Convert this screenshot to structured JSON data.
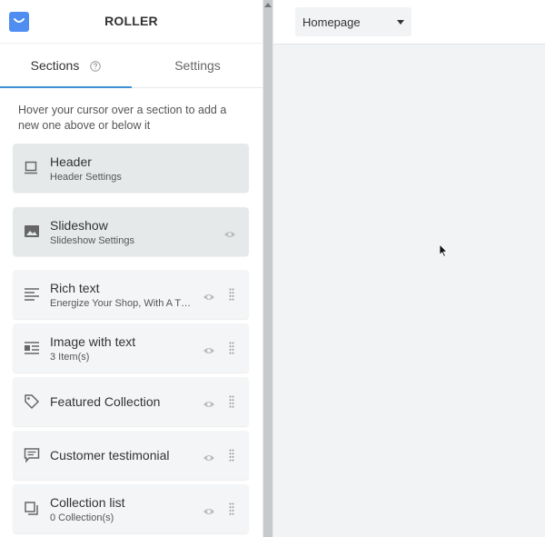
{
  "app": {
    "title": "ROLLER"
  },
  "tabs": {
    "sections": "Sections",
    "settings": "Settings"
  },
  "hint": "Hover your cursor over a section to add a new one above or below it",
  "sections": [
    {
      "name": "Header",
      "sub": "Header Settings",
      "icon": "header-icon"
    },
    {
      "name": "Slideshow",
      "sub": "Slideshow Settings",
      "icon": "image-icon"
    },
    {
      "name": "Rich text",
      "sub": "Energize Your Shop, With A The...",
      "icon": "text-align-icon"
    },
    {
      "name": "Image with text",
      "sub": "3 Item(s)",
      "icon": "image-text-icon"
    },
    {
      "name": "Featured Collection",
      "sub": "",
      "icon": "tag-icon"
    },
    {
      "name": "Customer testimonial",
      "sub": "",
      "icon": "comment-icon"
    },
    {
      "name": "Collection list",
      "sub": "0 Collection(s)",
      "icon": "collection-icon"
    }
  ],
  "preview": {
    "page_select": "Homepage"
  },
  "colors": {
    "accent": "#3d8fd6",
    "logo": "#4f8ef0"
  }
}
